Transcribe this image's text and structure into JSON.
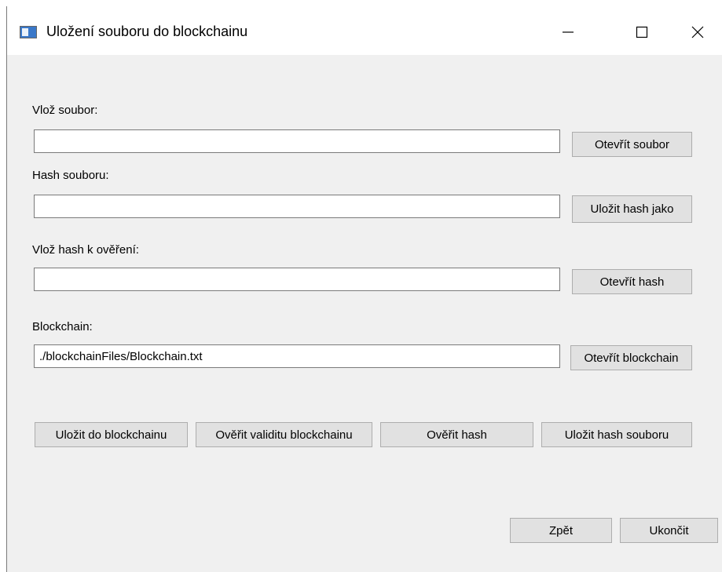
{
  "window": {
    "title": "Uložení souboru do blockchainu",
    "controls": {
      "minimize": "—",
      "maximize": "☐",
      "close": "✕"
    }
  },
  "form": {
    "file_label": "Vlož soubor:",
    "file_value": "",
    "open_file_button": "Otevřít soubor",
    "hash_label": "Hash souboru:",
    "hash_value": "",
    "save_hash_as_button": "Uložit hash jako",
    "verify_hash_label": "Vlož hash k ověření:",
    "verify_hash_value": "",
    "open_hash_button": "Otevřít hash",
    "blockchain_label": "Blockchain:",
    "blockchain_value": "./blockchainFiles/Blockchain.txt",
    "open_blockchain_button": "Otevřít blockchain"
  },
  "actions": {
    "save_to_blockchain": "Uložit do blockchainu",
    "verify_blockchain_validity": "Ověřit validitu blockchainu",
    "verify_hash": "Ověřit hash",
    "save_file_hash": "Uložit hash souboru"
  },
  "footer": {
    "back": "Zpět",
    "quit": "Ukončit"
  }
}
